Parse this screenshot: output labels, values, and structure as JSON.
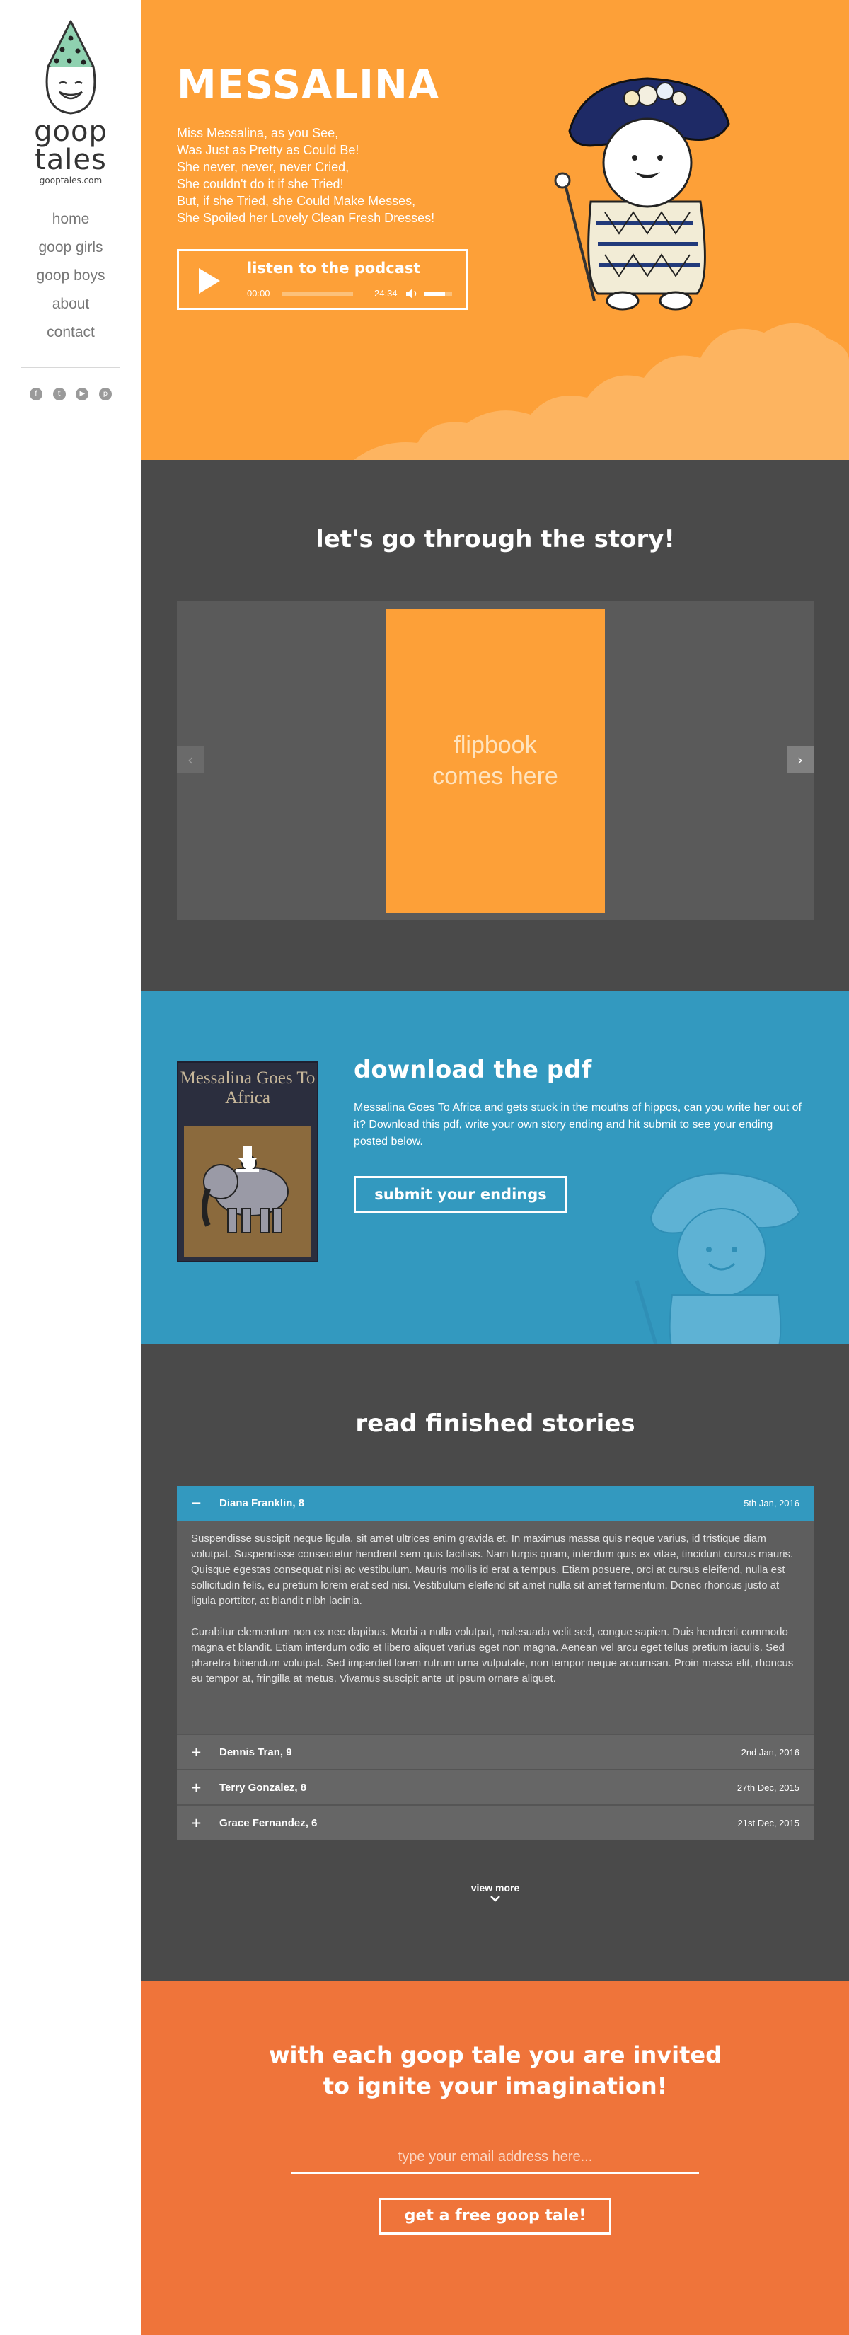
{
  "brand": {
    "logo_line1": "goop",
    "logo_line2": "tales",
    "logo_url": "gooptales.com"
  },
  "nav": {
    "items": [
      {
        "label": "home"
      },
      {
        "label": "goop girls"
      },
      {
        "label": "goop boys"
      },
      {
        "label": "about"
      },
      {
        "label": "contact"
      }
    ]
  },
  "social": {
    "icons": [
      "facebook-icon",
      "twitter-icon",
      "youtube-icon",
      "pinterest-icon"
    ]
  },
  "hero": {
    "title": "MESSALINA",
    "poem": [
      "Miss Messalina, as you See,",
      "Was Just as Pretty as Could Be!",
      "She never, never, never Cried,",
      "She couldn't do it if she Tried!",
      "But, if she Tried, she Could Make Messes,",
      "She Spoiled her Lovely Clean Fresh Dresses!"
    ],
    "podcast": {
      "label": "listen to the podcast",
      "time_current": "00:00",
      "time_total": "24:34",
      "progress": 0,
      "volume": 0.75
    }
  },
  "story": {
    "title": "let's go through the story!",
    "flipbook_placeholder": "flipbook comes here",
    "prev_label": "‹",
    "next_label": "›"
  },
  "pdf": {
    "book_title": "Messalina Goes To Africa",
    "title": "download the pdf",
    "description": "Messalina Goes To Africa and gets stuck in the mouths of hippos, can you write her out of it? Download this pdf, write your own story ending and hit submit to see your ending posted below.",
    "submit_label": "submit your endings"
  },
  "finished": {
    "title": "read finished stories",
    "open_item": {
      "sign": "−",
      "name": "Diana Franklin, 8",
      "date": "5th Jan, 2016",
      "paragraphs": [
        "Suspendisse suscipit neque ligula, sit amet ultrices enim gravida et. In maximus massa quis neque varius, id tristique diam volutpat. Suspendisse consectetur hendrerit sem quis facilisis. Nam turpis quam, interdum quis ex vitae, tincidunt cursus mauris. Quisque egestas consequat nisi ac vestibulum. Mauris mollis id erat a tempus. Etiam posuere, orci at cursus eleifend, nulla est sollicitudin felis, eu pretium lorem erat sed nisi. Vestibulum eleifend sit amet nulla sit amet fermentum. Donec rhoncus justo at ligula porttitor, at blandit nibh lacinia.",
        "Curabitur elementum non ex nec dapibus. Morbi a nulla volutpat, malesuada velit sed, congue sapien. Duis hendrerit commodo magna et blandit. Etiam interdum odio et libero aliquet varius eget non magna. Aenean vel arcu eget tellus pretium iaculis. Sed pharetra bibendum volutpat. Sed imperdiet lorem rutrum urna vulputate, non tempor neque accumsan. Proin massa elit, rhoncus eu tempor at, fringilla at metus. Vivamus suscipit ante ut ipsum ornare aliquet."
      ]
    },
    "items": [
      {
        "sign": "+",
        "name": "Dennis Tran, 9",
        "date": "2nd Jan, 2016"
      },
      {
        "sign": "+",
        "name": "Terry Gonzalez, 8",
        "date": "27th Dec, 2015"
      },
      {
        "sign": "+",
        "name": "Grace Fernandez, 6",
        "date": "21st Dec, 2015"
      }
    ],
    "view_more": "view more"
  },
  "subscribe": {
    "title_line1": "with each goop tale you are invited",
    "title_line2": "to ignite your imagination!",
    "email_placeholder": "type your email address here...",
    "cta_label": "get a free goop tale!"
  },
  "colors": {
    "hero_orange": "#fda038",
    "dark_gray": "#4a4a4a",
    "blue": "#3399bf",
    "subscribe_orange": "#ef743a"
  }
}
